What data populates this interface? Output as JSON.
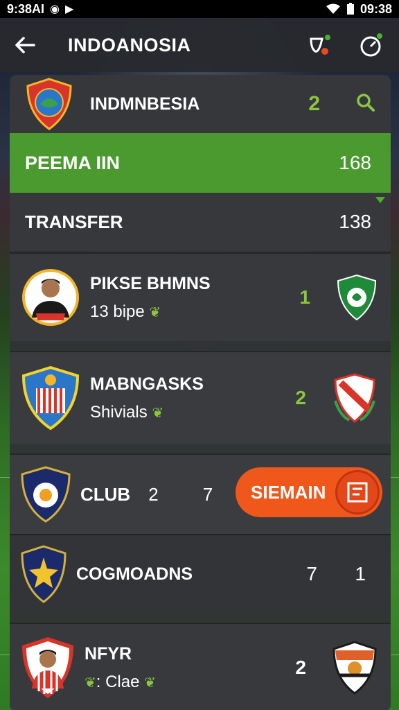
{
  "status_bar": {
    "time": "9:38AI",
    "clock": "09:38",
    "icons": [
      "signal-icon",
      "wifi-icon",
      "battery-icon"
    ]
  },
  "app_bar": {
    "title": "INDOANOSIA",
    "icons": [
      "back-arrow-icon",
      "whistle-icon",
      "stopwatch-icon"
    ]
  },
  "header": {
    "team_name": "INDMNBESIA",
    "count": "2",
    "icon": "search-icon"
  },
  "premium_row": {
    "label": "PEEMA IIN",
    "value": "168"
  },
  "transfer_row": {
    "label": "TRANSFER",
    "value": "138"
  },
  "cards": [
    {
      "title": "PIKSE BHMNS",
      "subtitle": "13 bipe",
      "score": "1"
    },
    {
      "title": "MABNGASKS",
      "subtitle": "Shivials",
      "score": "2"
    },
    {
      "label": "CLUB",
      "value_a": "2",
      "value_b": "7",
      "pill_label": "SIEMAIN"
    },
    {
      "title": "COGMOADNS",
      "value_a": "7",
      "value_b": "1"
    },
    {
      "title": "NFYR",
      "subtitle": ": Clae",
      "score": "2"
    }
  ],
  "colors": {
    "accent_green": "#4a9a30",
    "score_green": "#8cc63f",
    "pill_orange": "#f0571a",
    "panel": "#303236"
  }
}
